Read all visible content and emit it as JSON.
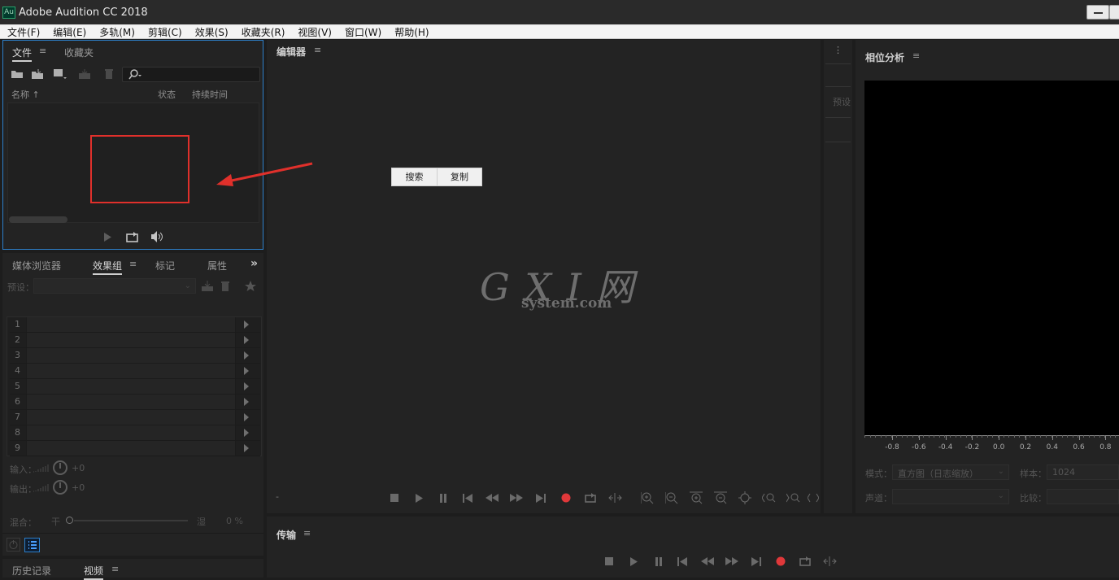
{
  "window": {
    "title": "Adobe Audition CC 2018",
    "logo_text": "Au"
  },
  "menu": [
    "文件(F)",
    "编辑(E)",
    "多轨(M)",
    "剪辑(C)",
    "效果(S)",
    "收藏夹(R)",
    "视图(V)",
    "窗口(W)",
    "帮助(H)"
  ],
  "files_panel": {
    "tabs": [
      "文件",
      "收藏夹"
    ],
    "columns": [
      "名称",
      "状态",
      "持续时间"
    ]
  },
  "effects_panel": {
    "tabs": [
      "媒体浏览器",
      "效果组",
      "标记",
      "属性"
    ],
    "preset_label": "预设：",
    "rack_slots": [
      "1",
      "2",
      "3",
      "4",
      "5",
      "6",
      "7",
      "8",
      "9"
    ],
    "input_label": "输入：",
    "input_value": "+0",
    "output_label": "输出：",
    "output_value": "+0",
    "mix_label": "混合：",
    "mix_dry": "干",
    "mix_wet": "湿",
    "mix_value": "0 %"
  },
  "bottom_left_tabs": [
    "历史记录",
    "视频"
  ],
  "editor": {
    "title": "编辑器",
    "context_buttons": [
      "搜索",
      "复制"
    ],
    "watermark_main": "G X I 网",
    "watermark_sub": "system.com",
    "time_display": "-"
  },
  "side_strip": {
    "label": "预设"
  },
  "transport": {
    "title": "传输"
  },
  "phase_panel": {
    "title": "相位分析",
    "ticks": [
      "-0.8",
      "-0.6",
      "-0.4",
      "-0.2",
      "0.0",
      "0.2",
      "0.4",
      "0.6",
      "0.8"
    ],
    "mode_label": "模式：",
    "mode_value": "直方图（日志缩放）",
    "sample_label": "样本：",
    "sample_value": "1024",
    "channel_label": "声道：",
    "compare_label": "比较："
  },
  "colors": {
    "record": "#e0383a",
    "annotation": "#e0302b",
    "panel_focus": "#2d7fc9"
  }
}
